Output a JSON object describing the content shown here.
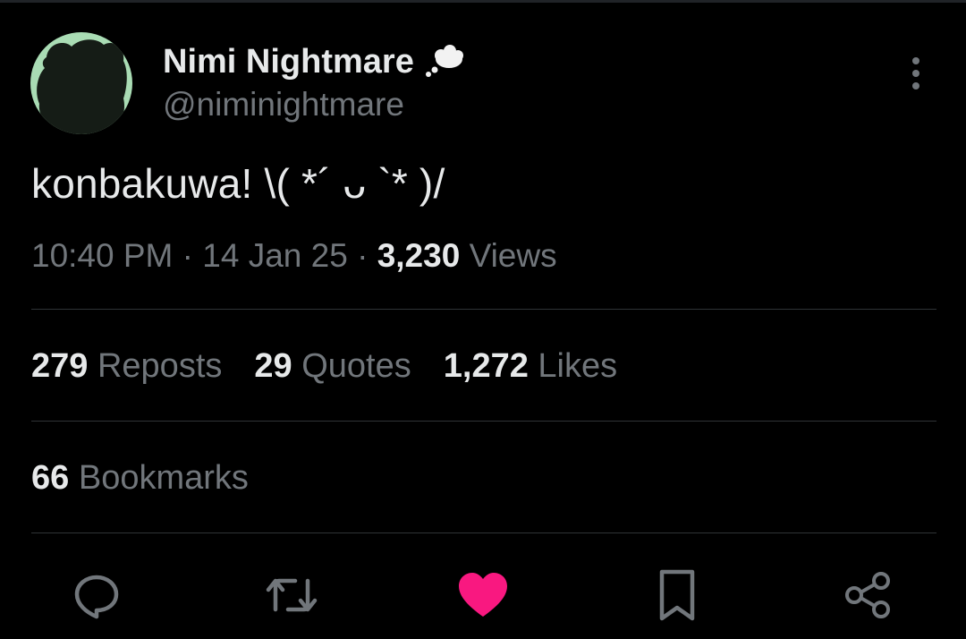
{
  "author": {
    "display_name": "Nimi Nightmare",
    "handle": "@niminightmare",
    "badge_icon": "thought-cloud-icon"
  },
  "tweet": {
    "text": "konbakuwa! \\( *´ ᴗ `* )/"
  },
  "meta": {
    "time": "10:40 PM",
    "separator": " · ",
    "date": "14 Jan 25",
    "views_count": "3,230",
    "views_label": "Views"
  },
  "stats": {
    "reposts_count": "279",
    "reposts_label": "Reposts",
    "quotes_count": "29",
    "quotes_label": "Quotes",
    "likes_count": "1,272",
    "likes_label": "Likes",
    "bookmarks_count": "66",
    "bookmarks_label": "Bookmarks"
  },
  "actions": [
    {
      "name": "reply",
      "icon": "reply-icon"
    },
    {
      "name": "repost",
      "icon": "repost-icon"
    },
    {
      "name": "like",
      "icon": "heart-icon",
      "state": "liked"
    },
    {
      "name": "bookmark",
      "icon": "bookmark-icon"
    },
    {
      "name": "share",
      "icon": "share-icon"
    }
  ],
  "colors": {
    "background": "#000000",
    "primary_text": "#e7e9ea",
    "secondary_text": "#71767b",
    "divider": "#2f3336",
    "like_active": "#f91880",
    "avatar_bg": "#a9dcb4"
  }
}
